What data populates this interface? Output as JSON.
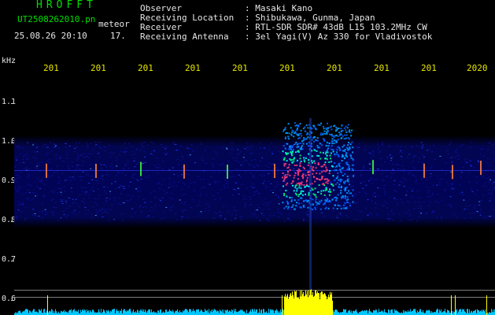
{
  "header": {
    "brand": "HROFFT",
    "filename": "UT2508262010.pn",
    "filetype": "meteor",
    "datetime": "25.08.26 20:10",
    "frame": "17.",
    "fields": [
      {
        "label": "Observer",
        "value": ": Masaki Kano"
      },
      {
        "label": "Receiving Location",
        "value": ": Shibukawa, Gunma, Japan"
      },
      {
        "label": "Receiver",
        "value": ": RTL-SDR SDR# 43dB L15 103.2MHz CW"
      },
      {
        "label": "Receiving Antenna",
        "value": ": 3el Yagi(V) Az 330 for Vladivostok"
      }
    ]
  },
  "axis": {
    "unit": "kHz",
    "y_ticks": [
      "1.1",
      "1.0",
      "0.9",
      "0.8",
      "0.7",
      "0.6"
    ],
    "x_ticks": [
      "201",
      "201",
      "201",
      "201",
      "201",
      "201",
      "201",
      "201",
      "201",
      "2020"
    ]
  },
  "colors": {
    "background": "#000000",
    "text": "#e6e6e6",
    "brand": "#00e000",
    "time_labels": "#e8e800",
    "noise_band": "#02065a",
    "echo_core": "#ff3c7a",
    "echo_mid": "#00ffff",
    "power_trace": "#00c8ff",
    "power_peak": "#ffff00"
  }
}
